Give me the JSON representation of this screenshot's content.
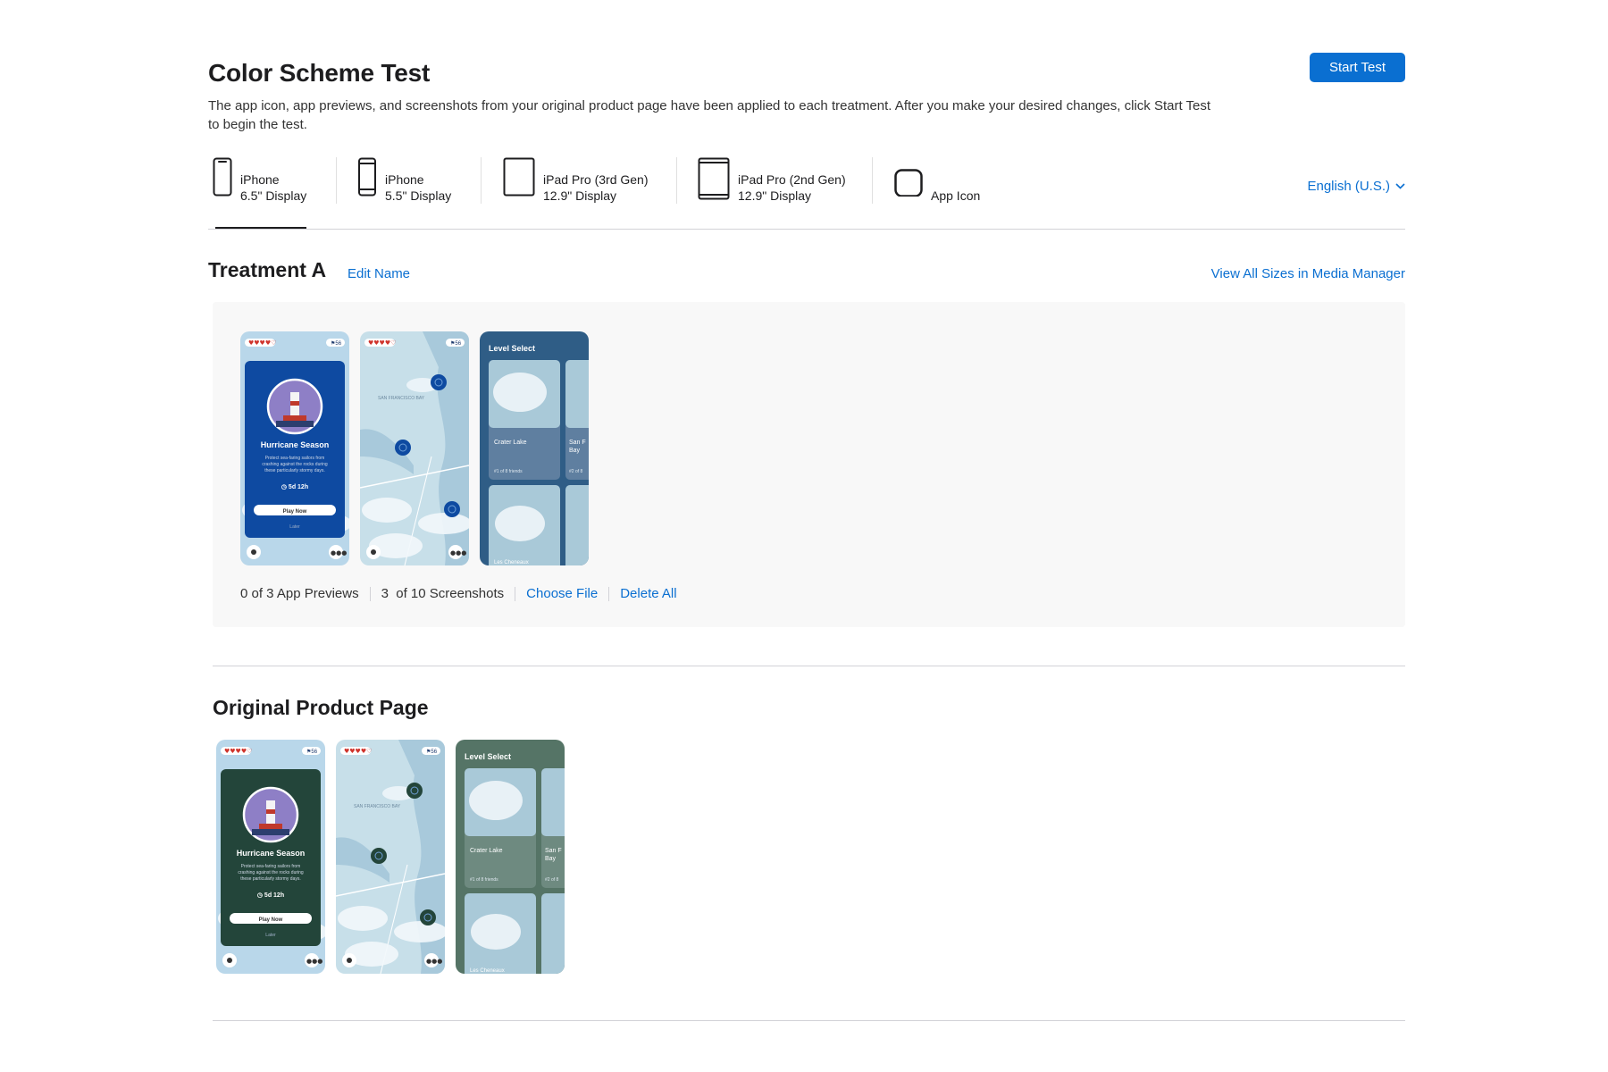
{
  "header": {
    "title": "Color Scheme Test",
    "description": "The app icon, app previews, and screenshots from your original product page have been applied to each treatment. After you make your desired changes, click Start Test to begin the test.",
    "start_button": "Start Test"
  },
  "devices": [
    {
      "line1": "iPhone",
      "line2": "6.5\" Display",
      "icon": "iphone-icon",
      "active": true
    },
    {
      "line1": "iPhone",
      "line2": "5.5\" Display",
      "icon": "iphone-icon"
    },
    {
      "line1": "iPad Pro (3rd Gen)",
      "line2": "12.9\" Display",
      "icon": "ipad-icon"
    },
    {
      "line1": "iPad Pro (2nd Gen)",
      "line2": "12.9\" Display",
      "icon": "ipad-icon"
    },
    {
      "line1": "App Icon",
      "line2": "",
      "icon": "app-icon-icon"
    }
  ],
  "language": "English (U.S.)",
  "treatment": {
    "title": "Treatment A",
    "edit_name": "Edit Name",
    "view_all": "View All Sizes in Media Manager",
    "previews_count": "0 of 3 App Previews",
    "screenshots_count": "3  of 10 Screenshots",
    "choose_file": "Choose File",
    "delete_all": "Delete All",
    "accent_color": "#0e4aa1"
  },
  "original": {
    "title": "Original Product Page",
    "accent_color": "#23453a"
  },
  "screenshot_text": {
    "card_title": "Hurricane Season",
    "card_body": [
      "Protect sea-faring sailors from",
      "crashing against the rocks during",
      "these particularly stormy days."
    ],
    "timer": "5d 12h",
    "play_button": "Play Now",
    "later": "Later",
    "map_label": "SAN FRANCISCO BAY",
    "level_select": "Level Select",
    "level_1": "Crater Lake",
    "level_1_sub": "#1 of 8 friends",
    "level_2a": "San F",
    "level_2b": "Bay",
    "level_2_sub": "#2 of 8",
    "level_3": "Les Cheneaux",
    "flag_count": "56"
  }
}
